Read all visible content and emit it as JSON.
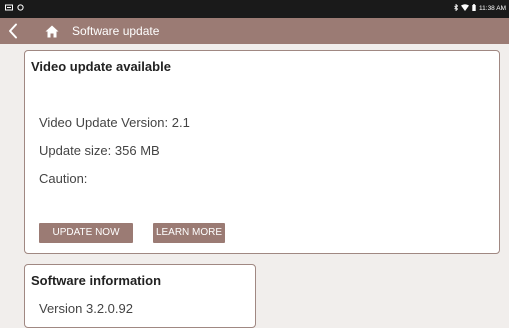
{
  "status_bar": {
    "left_icons": [
      "notification-icon",
      "camera-icon"
    ],
    "right_icons": [
      "bluetooth-icon",
      "wifi-icon",
      "battery-icon"
    ],
    "time": "11:38 AM"
  },
  "app_bar": {
    "title": "Software update",
    "back_icon": "back-arrow-icon",
    "home_icon": "home-icon",
    "background": "#9b7b74"
  },
  "video_card": {
    "title": "Video update available",
    "version_label": "Video Update Version:",
    "version_value": "2.1",
    "size_label": "Update size:",
    "size_value": "356 MB",
    "caution_label": "Caution:",
    "update_button": "UPDATE NOW",
    "learn_button": "LEARN MORE"
  },
  "software_card": {
    "title": "Software information",
    "version_text": "Version 3.2.0.92"
  },
  "colors": {
    "accent": "#9b7b74",
    "card_border": "#a08882",
    "background": "#f1eeec"
  }
}
